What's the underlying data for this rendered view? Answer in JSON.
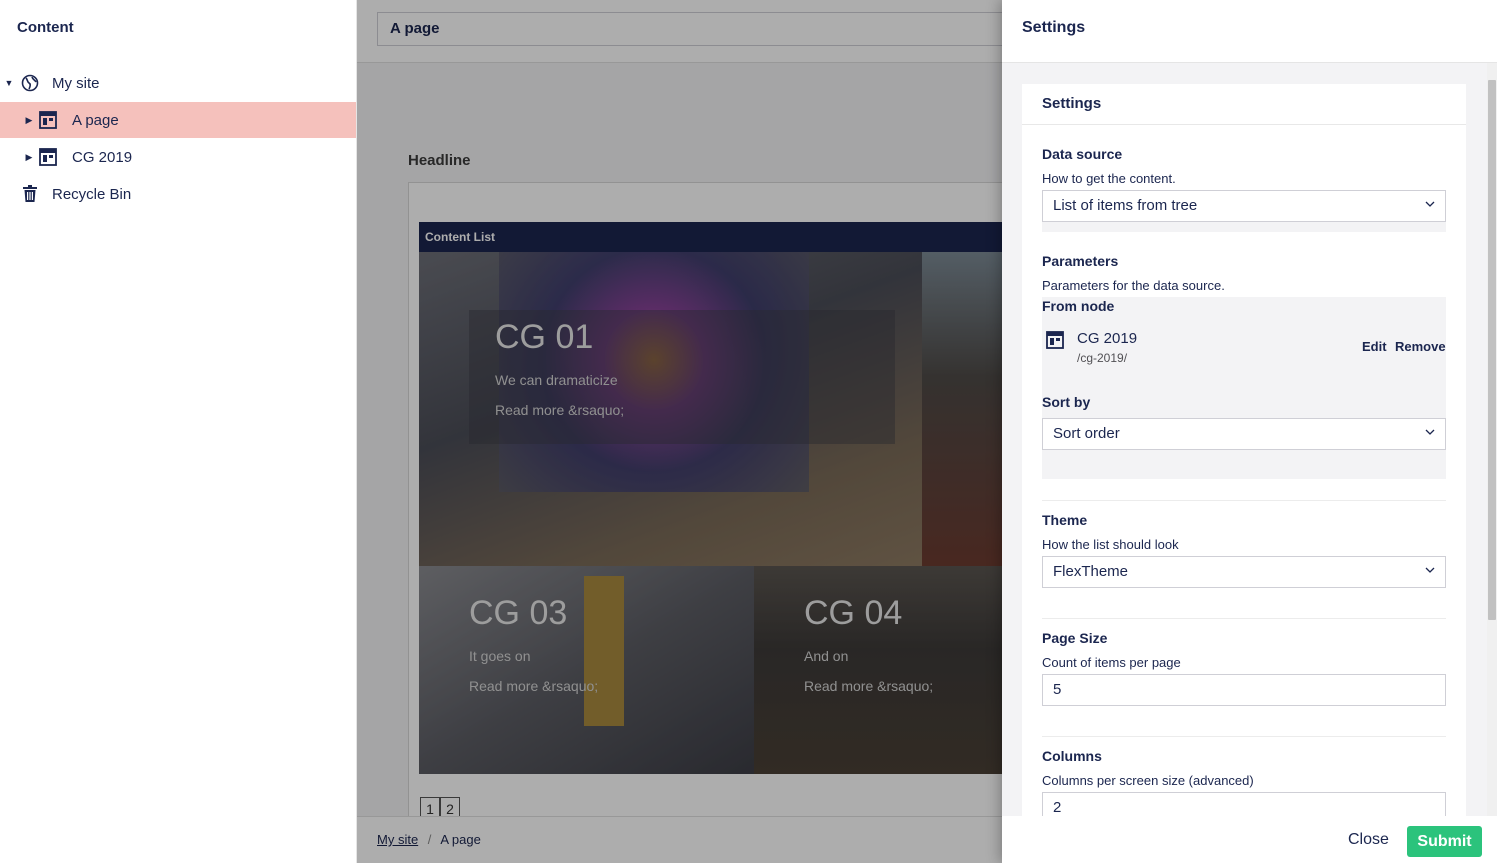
{
  "tree": {
    "header": "Content",
    "items": [
      {
        "label": "My site",
        "icon": "globe-icon"
      },
      {
        "label": "A page",
        "icon": "document-grid-icon"
      },
      {
        "label": "CG 2019",
        "icon": "document-grid-icon"
      },
      {
        "label": "Recycle Bin",
        "icon": "trash-icon"
      }
    ]
  },
  "editor": {
    "page_name": "A page",
    "headline_label": "Headline",
    "content_list_label": "Content List",
    "tiles": [
      {
        "title": "CG 01",
        "text": "We can dramaticize",
        "read_more": "Read more &rsaquo;"
      },
      {
        "title": "CG 03",
        "text": "It goes on",
        "read_more": "Read more &rsaquo;"
      },
      {
        "title": "CG 04",
        "text": "And on",
        "read_more": "Read more &rsaquo;"
      }
    ],
    "pager": [
      "1",
      "2"
    ],
    "breadcrumb": {
      "root": "My site",
      "separator": "/",
      "current": "A page"
    }
  },
  "settings": {
    "panel_title": "Settings",
    "box_title": "Settings",
    "data_source": {
      "label": "Data source",
      "description": "How to get the content.",
      "value": "List of items from tree"
    },
    "parameters": {
      "label": "Parameters",
      "description": "Parameters for the data source.",
      "from_node_label": "From node",
      "node_name": "CG 2019",
      "node_path": "/cg-2019/",
      "edit_label": "Edit",
      "remove_label": "Remove",
      "sort_by_label": "Sort by",
      "sort_by_value": "Sort order"
    },
    "theme": {
      "label": "Theme",
      "description": "How the list should look",
      "value": "FlexTheme"
    },
    "page_size": {
      "label": "Page Size",
      "description": "Count of items per page",
      "value": "5"
    },
    "columns": {
      "label": "Columns",
      "description": "Columns per screen size (advanced)",
      "value": "2"
    },
    "close_label": "Close",
    "submit_label": "Submit"
  },
  "colors": {
    "brand_navy": "#1b264f",
    "selected_row": "#f5c1bc",
    "submit_green": "#2bc37c"
  }
}
